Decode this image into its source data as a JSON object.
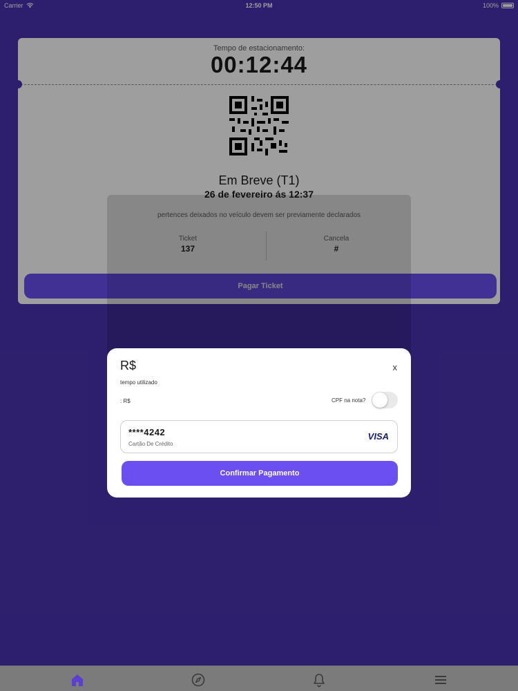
{
  "status_bar": {
    "carrier": "Carrier",
    "time": "12:50 PM",
    "battery": "100%"
  },
  "ticket": {
    "time_label": "Tempo de estacionamento:",
    "timer": "00:12:44",
    "place": "Em Breve (T1)",
    "date": "26 de fevereiro ás 12:37",
    "notice": "pertences deixados no veículo devem ser previamente declarados",
    "ticket_label": "Ticket",
    "ticket_value": "137",
    "gate_label": "Cancela",
    "gate_value": "#",
    "pay_button": "Pagar Ticket"
  },
  "modal": {
    "currency": "R$",
    "close": "x",
    "time_used": "tempo utilizado",
    "rs_label": ": R$",
    "cpf_label": "CPF na nota?",
    "cpf_toggle_on": false,
    "card_number": "****4242",
    "card_type": "Cartão De Crédito",
    "card_brand": "VISA",
    "confirm_button": "Confirmar Pagamento"
  },
  "tab_bar": {
    "items": [
      {
        "icon": "home-icon",
        "active": true
      },
      {
        "icon": "compass-icon",
        "active": false
      },
      {
        "icon": "bell-icon",
        "active": false
      },
      {
        "icon": "menu-icon",
        "active": false
      }
    ]
  },
  "colors": {
    "background": "#4a33b0",
    "accent": "#6b4ff0",
    "visa": "#1a1f71"
  }
}
